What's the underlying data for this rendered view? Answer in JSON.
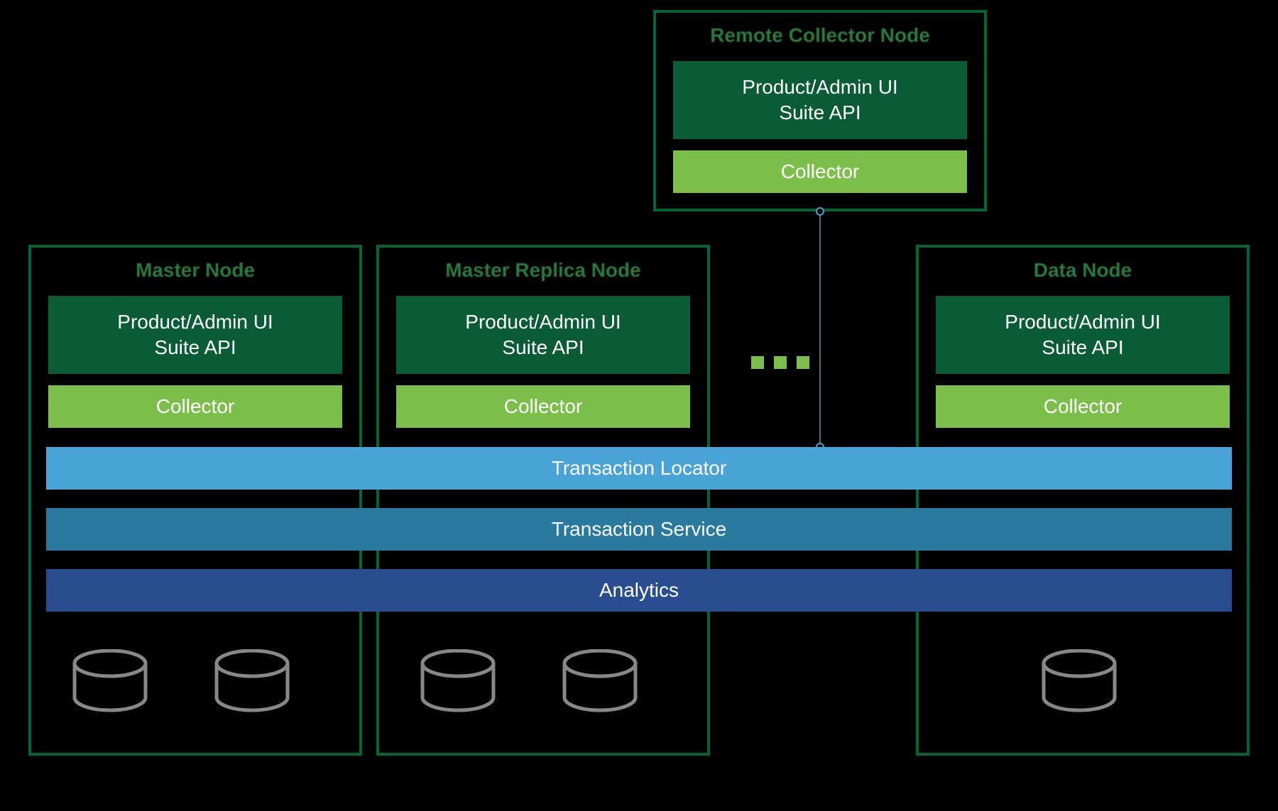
{
  "remote_node": {
    "title": "Remote Collector Node",
    "ui_line1": "Product/Admin UI",
    "ui_line2": "Suite API",
    "collector": "Collector"
  },
  "master_node": {
    "title": "Master Node",
    "ui_line1": "Product/Admin UI",
    "ui_line2": "Suite API",
    "collector": "Collector"
  },
  "replica_node": {
    "title": "Master Replica Node",
    "ui_line1": "Product/Admin UI",
    "ui_line2": "Suite API",
    "collector": "Collector"
  },
  "data_node": {
    "title": "Data Node",
    "ui_line1": "Product/Admin UI",
    "ui_line2": "Suite API",
    "collector": "Collector"
  },
  "bars": {
    "locator": "Transaction Locator",
    "service": "Transaction Service",
    "analytics": "Analytics"
  }
}
